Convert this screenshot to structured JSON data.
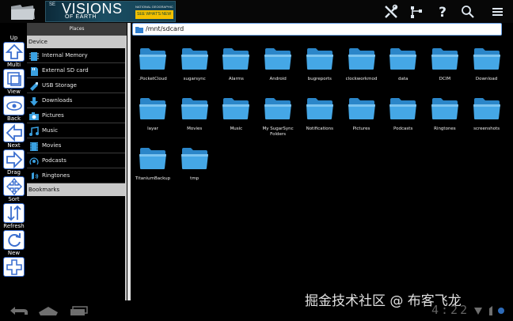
{
  "banner": {
    "small": "SE",
    "title": "VISIONS",
    "subtitle": "OF EARTH",
    "brand": "NATIONAL GEOGRAPHIC",
    "cta": "SEE WHAT'S NEW"
  },
  "toolbar": [
    {
      "label": "Up",
      "icon": "up-arrow-icon"
    },
    {
      "label": "Multi",
      "icon": "multi-select-icon"
    },
    {
      "label": "View",
      "icon": "eye-icon"
    },
    {
      "label": "Back",
      "icon": "back-arrow-icon"
    },
    {
      "label": "Next",
      "icon": "next-arrow-icon"
    },
    {
      "label": "Drag",
      "icon": "drag-cross-icon"
    },
    {
      "label": "Sort",
      "icon": "sort-icon"
    },
    {
      "label": "Refresh",
      "icon": "refresh-icon"
    },
    {
      "label": "New",
      "icon": "plus-icon"
    }
  ],
  "places": {
    "header": "Places",
    "device_label": "Device",
    "items": [
      {
        "label": "Internal Memory",
        "icon": "memory-icon"
      },
      {
        "label": "External SD card",
        "icon": "sdcard-icon"
      },
      {
        "label": "USB Storage",
        "icon": "usb-icon"
      },
      {
        "label": "Downloads",
        "icon": "download-icon"
      },
      {
        "label": "Pictures",
        "icon": "camera-icon"
      },
      {
        "label": "Music",
        "icon": "music-icon"
      },
      {
        "label": "Movies",
        "icon": "film-icon"
      },
      {
        "label": "Podcasts",
        "icon": "podcast-icon"
      },
      {
        "label": "Ringtones",
        "icon": "ringtone-icon"
      }
    ],
    "bookmarks_label": "Bookmarks"
  },
  "path": "/mnt/sdcard",
  "files": [
    ".PocketCloud",
    "sugarsync",
    "Alarms",
    "Android",
    "bugreports",
    "clockworkmod",
    "data",
    "DCIM",
    "Download",
    "layar",
    "Movies",
    "Music",
    "My SugarSync Folders",
    "Notifications",
    "Pictures",
    "Podcasts",
    "Ringtones",
    "screenshots",
    "TitaniumBackup",
    "tmp"
  ],
  "watermark": "掘金技术社区 @ 布客飞龙",
  "clock": "4:22",
  "colors": {
    "folder": "#3aa0e0",
    "toolbar_border": "#3b6fd0",
    "path_border": "#6aa2e8"
  }
}
